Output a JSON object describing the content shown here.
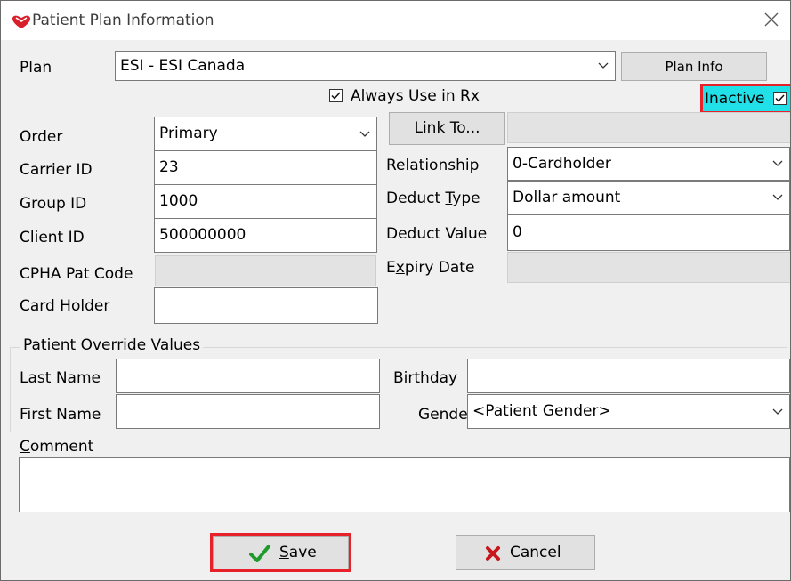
{
  "window": {
    "title": "Patient Plan Information"
  },
  "plan": {
    "label": "Plan",
    "value": "ESI - ESI Canada",
    "plan_info_button": "Plan Info",
    "always_use_label": "Always Use in Rx",
    "always_use_checked": true,
    "inactive_label": "Inactive",
    "inactive_checked": true
  },
  "order": {
    "label": "Order",
    "value": "Primary"
  },
  "link_to_button": "Link To...",
  "carrier_id": {
    "label": "Carrier ID",
    "value": "23"
  },
  "group_id": {
    "label": "Group ID",
    "value": "1000"
  },
  "client_id": {
    "label": "Client ID",
    "value": "500000000"
  },
  "cpha_pat_code": {
    "label": "CPHA Pat Code",
    "value": ""
  },
  "card_holder": {
    "label": "Card Holder",
    "value": ""
  },
  "relationship": {
    "label": "Relationship",
    "value": "0-Cardholder"
  },
  "deduct_type": {
    "label_pre": "Deduct ",
    "label_mnemonic": "T",
    "label_post": "ype",
    "value": "Dollar amount"
  },
  "deduct_value": {
    "label": "Deduct Value",
    "value": "0"
  },
  "expiry_date": {
    "label_pre": "E",
    "label_mnemonic": "x",
    "label_post": "piry Date",
    "value": ""
  },
  "override": {
    "legend": "Patient Override Values",
    "last_name": {
      "label": "Last Name",
      "value": ""
    },
    "first_name": {
      "label": "First Name",
      "value": ""
    },
    "birthday": {
      "label": "Birthday",
      "value": ""
    },
    "gender": {
      "label": "Gender",
      "value": "<Patient Gender>"
    }
  },
  "comment": {
    "label_mnemonic": "C",
    "label_post": "omment",
    "value": ""
  },
  "buttons": {
    "save_mnemonic": "S",
    "save_post": "ave",
    "cancel_label": "Cancel"
  },
  "colors": {
    "highlight_red": "#e8202a",
    "inactive_bg": "#21e0e8",
    "save_check_green": "#1f9a2c",
    "cancel_x_red": "#c8161d"
  }
}
